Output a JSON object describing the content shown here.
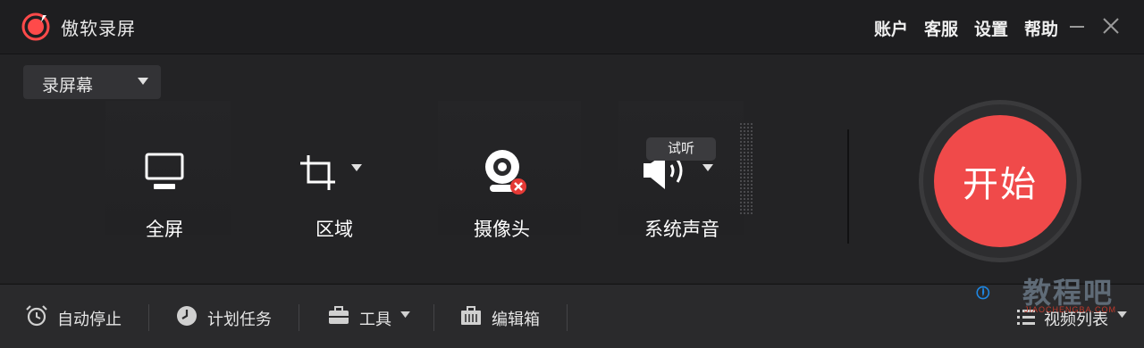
{
  "app": {
    "title": "傲软录屏"
  },
  "top_menu": {
    "account": "账户",
    "service": "客服",
    "settings": "设置",
    "help": "帮助"
  },
  "mode": {
    "selected": "录屏幕"
  },
  "features": {
    "fullscreen": "全屏",
    "region": "区域",
    "camera": "摄像头",
    "system_audio": "系统声音",
    "listen": "试听"
  },
  "start": {
    "label": "开始"
  },
  "bottom": {
    "auto_stop": "自动停止",
    "schedule": "计划任务",
    "tools": "工具",
    "editor": "编辑箱",
    "video_list": "视频列表"
  },
  "watermark": {
    "text": "教程吧",
    "sub": "JIAOCHENGBA.COM"
  },
  "colors": {
    "accent": "#f04a4a",
    "background": "#232325",
    "bottombar": "#2a2a2c",
    "camera_error": "#e53935"
  }
}
